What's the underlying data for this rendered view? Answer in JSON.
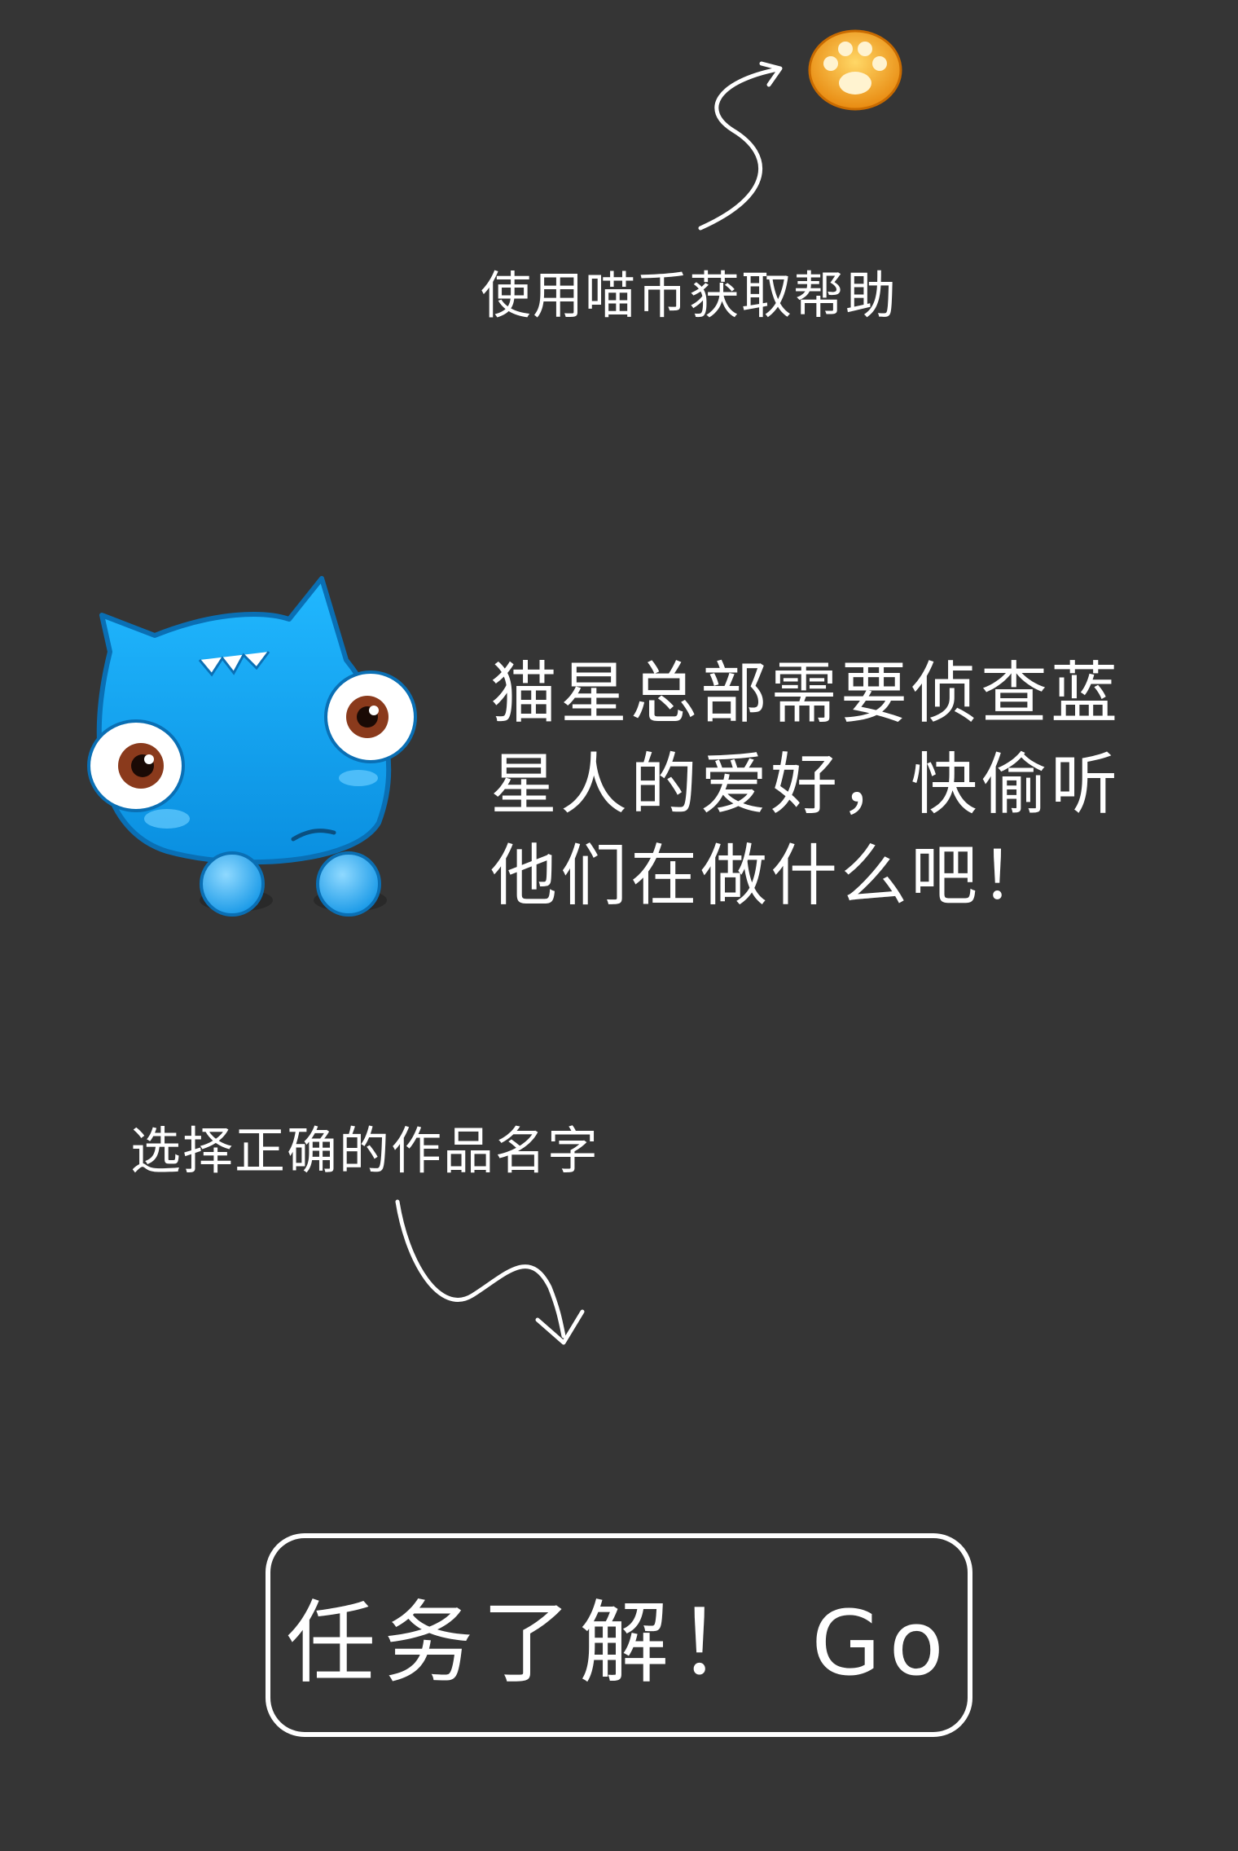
{
  "top_hint": {
    "text": "使用喵币获取帮助",
    "icon": "paw-coin-icon"
  },
  "mascot": {
    "icon": "blue-cat-mascot"
  },
  "mission": {
    "lines": [
      "猫星总部需要侦查蓝",
      "星人的爱好，快偷听",
      "他们在做什么吧！"
    ]
  },
  "bottom_hint": {
    "text": "选择正确的作品名字"
  },
  "go_button": {
    "label": "任务了解！ Go"
  },
  "colors": {
    "background": "#353535",
    "text": "#ffffff",
    "mascot_blue": "#1aa6f0",
    "paw_orange": "#f5a623"
  }
}
